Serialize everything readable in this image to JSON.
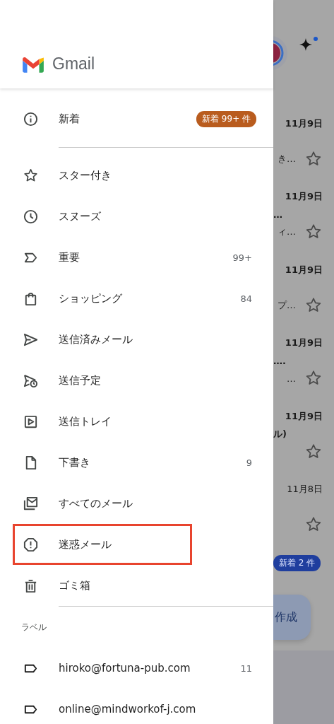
{
  "header": {
    "logo_text": "Gmail"
  },
  "primary": {
    "kind": "info",
    "label": "新着",
    "badge": "新着 99+ 件"
  },
  "folders": [
    {
      "kind": "star",
      "label": "スター付き",
      "highlighted": false
    },
    {
      "kind": "clock",
      "label": "スヌーズ",
      "highlighted": false
    },
    {
      "kind": "important",
      "label": "重要",
      "count": "99+",
      "highlighted": false
    },
    {
      "kind": "bag",
      "label": "ショッピング",
      "count": "84",
      "highlighted": false
    },
    {
      "kind": "send",
      "label": "送信済みメール",
      "highlighted": false
    },
    {
      "kind": "scheduled",
      "label": "送信予定",
      "highlighted": false
    },
    {
      "kind": "outbox",
      "label": "送信トレイ",
      "highlighted": false
    },
    {
      "kind": "draft",
      "label": "下書き",
      "count": "9",
      "highlighted": false
    },
    {
      "kind": "allmail",
      "label": "すべてのメール",
      "highlighted": false
    },
    {
      "kind": "spam",
      "label": "迷惑メール",
      "highlighted": true
    },
    {
      "kind": "trash",
      "label": "ゴミ箱",
      "highlighted": false
    }
  ],
  "labels_heading": "ラベル",
  "labels": [
    {
      "kind": "label",
      "label": "hiroko@fortuna-pub.com",
      "count": "11"
    },
    {
      "kind": "label",
      "label": "online@mindworkof-j.com"
    }
  ],
  "background": {
    "mails": [
      {
        "date": "11月9日",
        "unread": true,
        "line_2": "き…"
      },
      {
        "date": "11月9日",
        "unread": true,
        "line_1": "…",
        "line_2": "ィ…"
      },
      {
        "date": "11月9日",
        "unread": true,
        "line_2": "プ…"
      },
      {
        "date": "11月9日",
        "unread": true,
        "line_1": "….",
        "line_2": "…"
      },
      {
        "date": "11月9日",
        "unread": true,
        "line_1": "ル)"
      },
      {
        "date": "11月8日",
        "unread": false
      }
    ],
    "badge": "新着 2 件",
    "compose": "作成"
  }
}
